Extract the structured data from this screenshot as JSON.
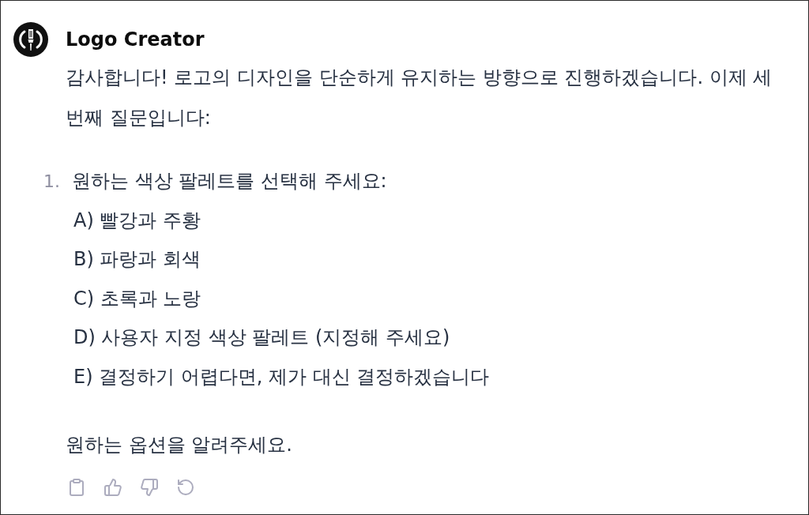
{
  "assistant": {
    "name": "Logo Creator"
  },
  "message": {
    "intro": "감사합니다! 로고의 디자인을 단순하게 유지하는 방향으로 진행하겠습니다. 이제 세 번째 질문입니다:",
    "list": [
      {
        "number": "1.",
        "text": "원하는 색상 팔레트를 선택해 주세요:",
        "options": [
          "A) 빨강과 주황",
          "B) 파랑과 회색",
          "C) 초록과 노랑",
          "D) 사용자 지정 색상 팔레트 (지정해 주세요)",
          "E) 결정하기 어렵다면, 제가 대신 결정하겠습니다"
        ]
      }
    ],
    "closing": "원하는 옵션을 알려주세요."
  },
  "actions": [
    {
      "kind": "copy"
    },
    {
      "kind": "thumbs_up"
    },
    {
      "kind": "thumbs_down"
    },
    {
      "kind": "regenerate"
    }
  ]
}
